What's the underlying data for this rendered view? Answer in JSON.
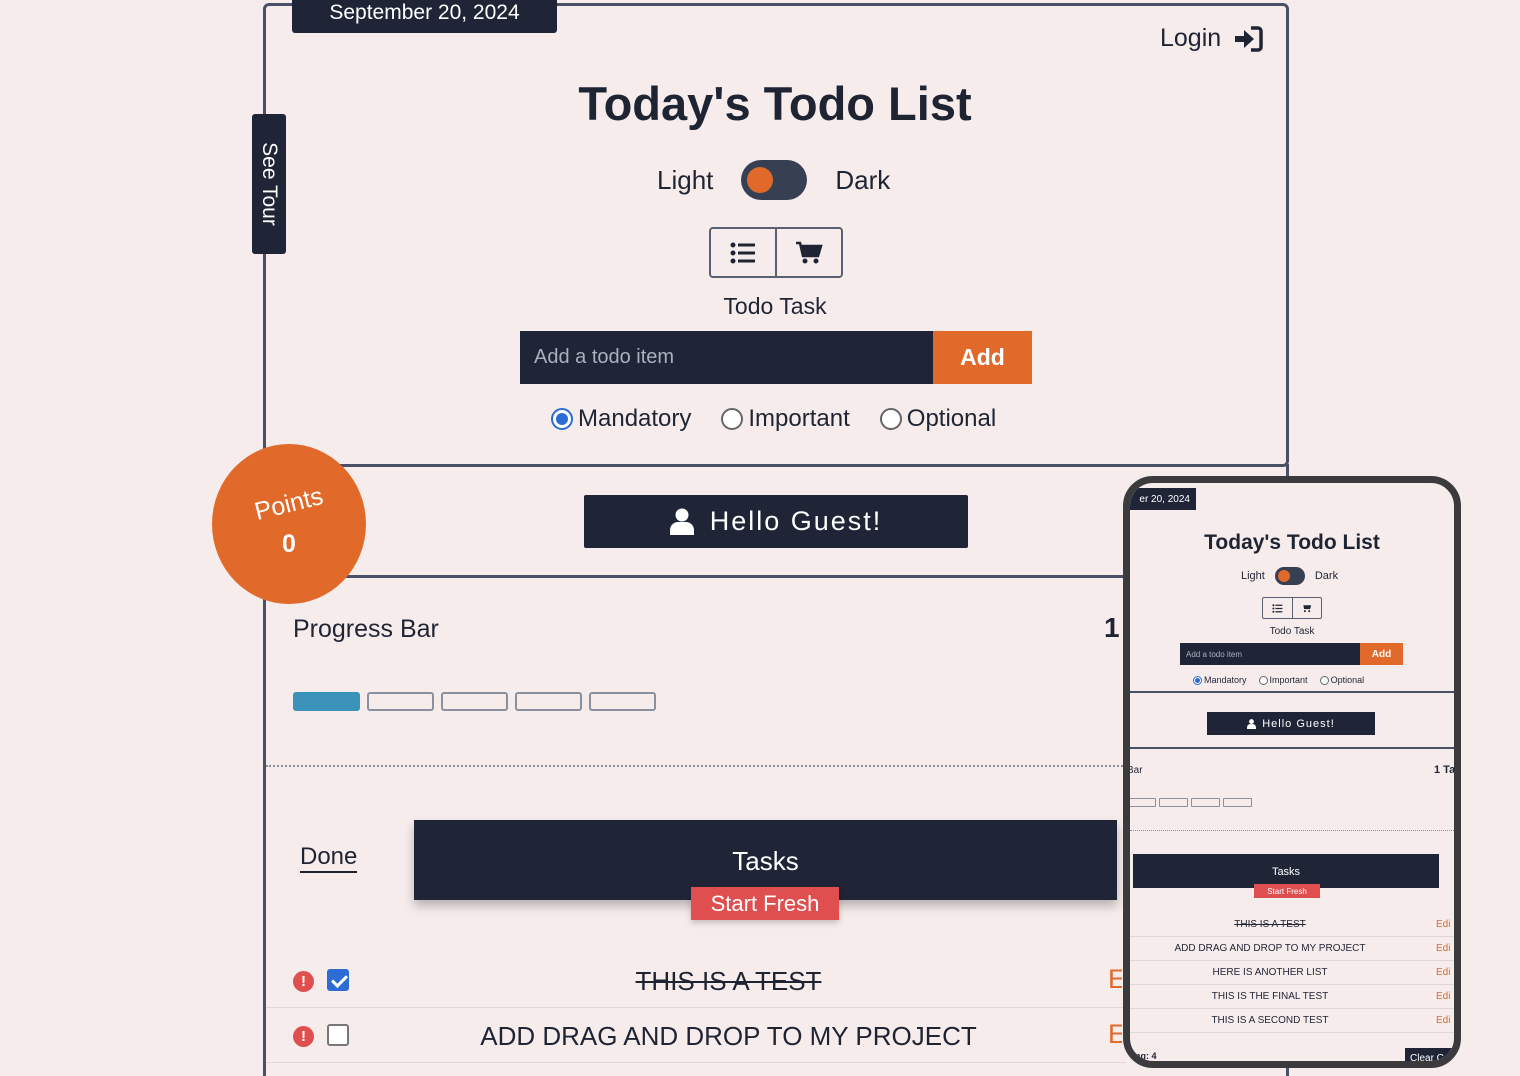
{
  "app": {
    "date": "September 20, 2024",
    "tour_label": "See Tour",
    "login_label": "Login",
    "title": "Today's Todo List",
    "theme": {
      "light_label": "Light",
      "dark_label": "Dark",
      "mode": "light"
    },
    "view_icons": [
      "list-icon",
      "cart-icon"
    ],
    "todo_label": "Todo Task",
    "input_placeholder": "Add a todo item",
    "add_label": "Add",
    "priorities": [
      {
        "label": "Mandatory",
        "selected": true
      },
      {
        "label": "Important",
        "selected": false
      },
      {
        "label": "Optional",
        "selected": false
      }
    ],
    "points": {
      "label": "Points",
      "value": "0"
    },
    "greeting": "Hello Guest!",
    "progress": {
      "label": "Progress Bar",
      "count": "1",
      "segments_total": 5,
      "segments_filled": 1
    },
    "done_link": "Done",
    "tasks_header": "Tasks",
    "start_fresh": "Start Fresh",
    "tasks": [
      {
        "text": "THIS IS A TEST",
        "done": true,
        "edit": "E"
      },
      {
        "text": "ADD DRAG AND DROP TO MY PROJECT",
        "done": false,
        "edit": "E"
      }
    ]
  },
  "phone": {
    "date": "er 20, 2024",
    "title": "Today's Todo List",
    "light_label": "Light",
    "dark_label": "Dark",
    "todo_label": "Todo Task",
    "input_placeholder": "Add a todo item",
    "add_label": "Add",
    "priorities": [
      "Mandatory",
      "Important",
      "Optional"
    ],
    "greeting": "Hello Guest!",
    "bar_label": "Bar",
    "count": "1 Ta",
    "tasks_header": "Tasks",
    "start_fresh": "Start Fresh",
    "tasks": [
      {
        "text": "THIS IS A TEST",
        "done": true,
        "edit": "Edi"
      },
      {
        "text": "ADD DRAG AND DROP TO MY PROJECT",
        "done": false,
        "edit": "Edi"
      },
      {
        "text": "HERE IS ANOTHER LIST",
        "done": false,
        "edit": "Edi"
      },
      {
        "text": "THIS IS THE FINAL TEST",
        "done": false,
        "edit": "Edi"
      },
      {
        "text": "THIS IS A SECOND TEST",
        "done": false,
        "edit": "Edi"
      }
    ],
    "remaining": "ning: 4",
    "clear_label": "Clear C"
  },
  "colors": {
    "background": "#f6ecec",
    "navy": "#1f2536",
    "orange": "#e16a2b",
    "red": "#e04f50",
    "progress_blue": "#3b93b9",
    "checkbox_blue": "#2c6cd4"
  }
}
